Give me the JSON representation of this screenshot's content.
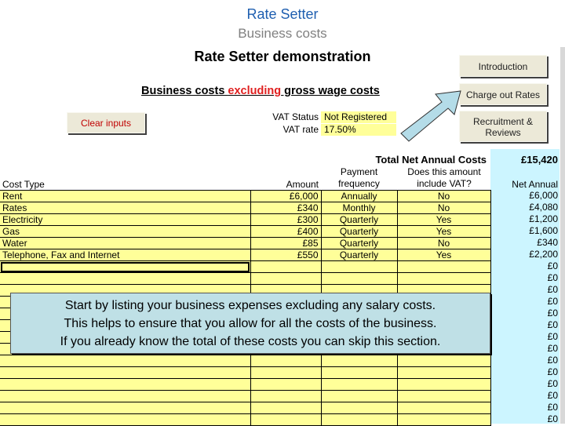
{
  "slide": {
    "title": "Rate Setter",
    "subtitle": "Business costs"
  },
  "sheet": {
    "title": "Rate Setter demonstration",
    "heading": {
      "part1": "Business costs ",
      "highlight": "excluding",
      "part2": " gross wage costs",
      "highlight_color": "#e02020"
    }
  },
  "nav_buttons": {
    "introduction": "Introduction",
    "charge_out_rates": "Charge out Rates",
    "recruitment_line1": "Recruitment &",
    "recruitment_line2": "Reviews",
    "clear_inputs": "Clear inputs"
  },
  "vat": {
    "status_label": "VAT Status",
    "status_value": "Not Registered",
    "rate_label": "VAT rate",
    "rate_value": "17.50%"
  },
  "totals": {
    "label": "Total Net Annual Costs",
    "value": "£15,420"
  },
  "table": {
    "headers": {
      "cost_type": "Cost Type",
      "amount": "Amount",
      "frequency_line1": "Payment",
      "frequency_line2": "frequency",
      "vat_line1": "Does this amount",
      "vat_line2": "include VAT?",
      "net_annual": "Net Annual"
    },
    "rows": [
      {
        "type": "Rent",
        "amount": "£6,000",
        "frequency": "Annually",
        "vat": "No",
        "net": "£6,000"
      },
      {
        "type": "Rates",
        "amount": "£340",
        "frequency": "Monthly",
        "vat": "No",
        "net": "£4,080"
      },
      {
        "type": "Electricity",
        "amount": "£300",
        "frequency": "Quarterly",
        "vat": "Yes",
        "net": "£1,200"
      },
      {
        "type": "Gas",
        "amount": "£400",
        "frequency": "Quarterly",
        "vat": "Yes",
        "net": "£1,600"
      },
      {
        "type": "Water",
        "amount": "£85",
        "frequency": "Quarterly",
        "vat": "No",
        "net": "£340"
      },
      {
        "type": "Telephone, Fax and Internet",
        "amount": "£550",
        "frequency": "Quarterly",
        "vat": "Yes",
        "net": "£2,200"
      },
      {
        "type": "",
        "amount": "",
        "frequency": "",
        "vat": "",
        "net": "£0"
      },
      {
        "type": "",
        "amount": "",
        "frequency": "",
        "vat": "",
        "net": "£0"
      },
      {
        "type": "",
        "amount": "",
        "frequency": "",
        "vat": "",
        "net": "£0"
      },
      {
        "type": "",
        "amount": "",
        "frequency": "",
        "vat": "",
        "net": "£0"
      },
      {
        "type": "",
        "amount": "",
        "frequency": "",
        "vat": "",
        "net": "£0"
      },
      {
        "type": "",
        "amount": "",
        "frequency": "",
        "vat": "",
        "net": "£0"
      },
      {
        "type": "",
        "amount": "",
        "frequency": "",
        "vat": "",
        "net": "£0"
      },
      {
        "type": "",
        "amount": "",
        "frequency": "",
        "vat": "",
        "net": "£0"
      },
      {
        "type": "",
        "amount": "",
        "frequency": "",
        "vat": "",
        "net": "£0"
      },
      {
        "type": "",
        "amount": "",
        "frequency": "",
        "vat": "",
        "net": "£0"
      },
      {
        "type": "",
        "amount": "",
        "frequency": "",
        "vat": "",
        "net": "£0"
      },
      {
        "type": "",
        "amount": "",
        "frequency": "",
        "vat": "",
        "net": "£0"
      },
      {
        "type": "",
        "amount": "",
        "frequency": "",
        "vat": "",
        "net": "£0"
      },
      {
        "type": "",
        "amount": "",
        "frequency": "",
        "vat": "",
        "net": "£0"
      }
    ]
  },
  "note": {
    "line1": "Start by listing your business expenses excluding any salary costs.",
    "line2": "This helps to ensure that you allow for all the costs of the business.",
    "line3": "If you already know the total of these costs you can skip this section."
  }
}
